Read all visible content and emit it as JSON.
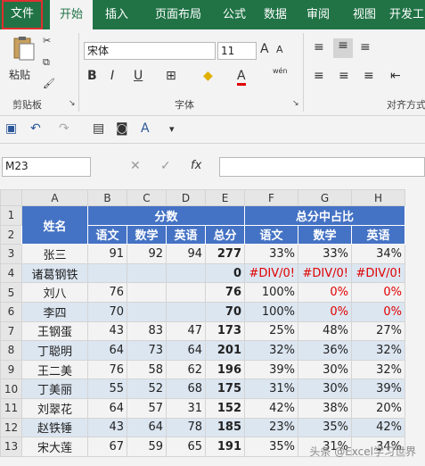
{
  "menu": {
    "tabs": [
      "文件",
      "开始",
      "插入",
      "页面布局",
      "公式",
      "数据",
      "审阅",
      "视图",
      "开发工"
    ]
  },
  "ribbon": {
    "paste_label": "粘贴",
    "clipboard_label": "剪贴板",
    "font_name": "宋体",
    "font_size": "11",
    "font_label": "字体",
    "align_label": "对齐方式",
    "font_a_big": "A",
    "font_a_small": "A",
    "wen_label": "wén"
  },
  "formula_bar": {
    "name_box": "M23",
    "fx": "fx",
    "formula": ""
  },
  "sheet": {
    "columns": [
      "A",
      "B",
      "C",
      "D",
      "E",
      "F",
      "G",
      "H"
    ],
    "header1": {
      "name": "姓名",
      "score": "分数",
      "ratio": "总分中占比"
    },
    "header2": [
      "语文",
      "数学",
      "英语",
      "总分",
      "语文",
      "数学",
      "英语"
    ],
    "rows": [
      {
        "n": "3",
        "name": "张三",
        "c": "91",
        "m": "92",
        "e": "94",
        "t": "277",
        "pc": "33%",
        "pm": "33%",
        "pe": "34%"
      },
      {
        "n": "4",
        "name": "诸葛钢铁",
        "c": "",
        "m": "",
        "e": "",
        "t": "0",
        "pc": "#DIV/0!",
        "pm": "#DIV/0!",
        "pe": "#DIV/0!"
      },
      {
        "n": "5",
        "name": "刘八",
        "c": "76",
        "m": "",
        "e": "",
        "t": "76",
        "pc": "100%",
        "pm": "0%",
        "pe": "0%"
      },
      {
        "n": "6",
        "name": "李四",
        "c": "70",
        "m": "",
        "e": "",
        "t": "70",
        "pc": "100%",
        "pm": "0%",
        "pe": "0%"
      },
      {
        "n": "7",
        "name": "王钢蛋",
        "c": "43",
        "m": "83",
        "e": "47",
        "t": "173",
        "pc": "25%",
        "pm": "48%",
        "pe": "27%"
      },
      {
        "n": "8",
        "name": "丁聪明",
        "c": "64",
        "m": "73",
        "e": "64",
        "t": "201",
        "pc": "32%",
        "pm": "36%",
        "pe": "32%"
      },
      {
        "n": "9",
        "name": "王二美",
        "c": "76",
        "m": "58",
        "e": "62",
        "t": "196",
        "pc": "39%",
        "pm": "30%",
        "pe": "32%"
      },
      {
        "n": "10",
        "name": "丁美丽",
        "c": "55",
        "m": "52",
        "e": "68",
        "t": "175",
        "pc": "31%",
        "pm": "30%",
        "pe": "39%"
      },
      {
        "n": "11",
        "name": "刘翠花",
        "c": "64",
        "m": "57",
        "e": "31",
        "t": "152",
        "pc": "42%",
        "pm": "38%",
        "pe": "20%"
      },
      {
        "n": "12",
        "name": "赵铁锤",
        "c": "43",
        "m": "64",
        "e": "78",
        "t": "185",
        "pc": "23%",
        "pm": "35%",
        "pe": "42%"
      },
      {
        "n": "13",
        "name": "宋大莲",
        "c": "67",
        "m": "59",
        "e": "65",
        "t": "191",
        "pc": "35%",
        "pm": "31%",
        "pe": "34%"
      }
    ],
    "red_values": [
      "#DIV/0!",
      "0%"
    ]
  },
  "watermark": "头条 @Excel学习世界"
}
